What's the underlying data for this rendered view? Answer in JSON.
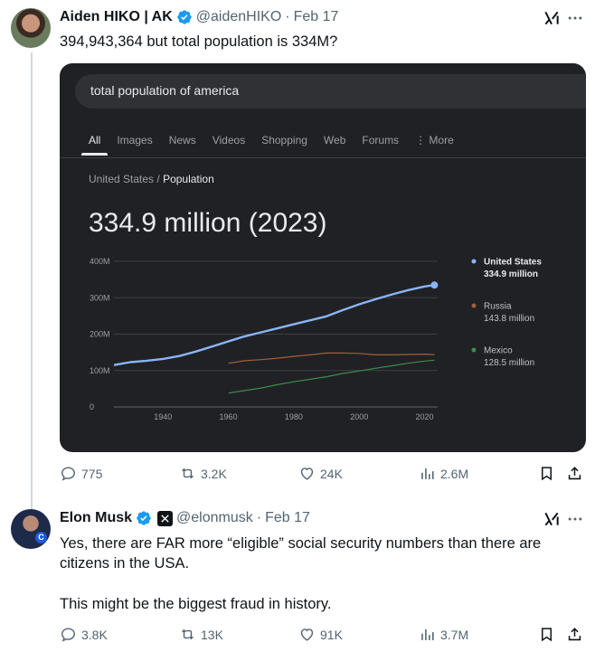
{
  "tweets": [
    {
      "name": "Aiden HIKO | AK",
      "handle": "@aidenHIKO",
      "date": "Feb 17",
      "text": "394,943,364 but total population is 334M?",
      "stats": {
        "replies": "775",
        "reposts": "3.2K",
        "likes": "24K",
        "views": "2.6M"
      }
    },
    {
      "name": "Elon Musk",
      "handle": "@elonmusk",
      "date": "Feb 17",
      "text_line1": "Yes, there are FAR more “eligible” social security numbers than there are",
      "text_line2": "citizens in the USA.",
      "text_line3": "This might be the biggest fraud in history.",
      "stats": {
        "replies": "3.8K",
        "reposts": "13K",
        "likes": "91K",
        "views": "3.7M"
      }
    }
  ],
  "embedded_search": {
    "query": "total population of america",
    "tabs": [
      "All",
      "Images",
      "News",
      "Videos",
      "Shopping",
      "Web",
      "Forums",
      "⋮ More"
    ],
    "active_tab": "All",
    "breadcrumb_parent": "United States",
    "breadcrumb_sep": " / ",
    "breadcrumb_current": "Population",
    "headline_value": "334.9 million (2023)"
  },
  "chart_data": {
    "type": "line",
    "y_ticks": [
      "400M",
      "300M",
      "200M",
      "100M",
      "0"
    ],
    "ylim": [
      0,
      400
    ],
    "xlim": [
      1925,
      2024
    ],
    "x_ticks": [
      1940,
      1960,
      1980,
      2000,
      2020
    ],
    "grid": true,
    "legend_position": "right",
    "series": [
      {
        "name": "United States",
        "label": "334.9 million",
        "color": "#8ab4f8",
        "x": [
          1925,
          1930,
          1935,
          1940,
          1945,
          1950,
          1955,
          1960,
          1965,
          1970,
          1975,
          1980,
          1985,
          1990,
          1995,
          2000,
          2005,
          2010,
          2015,
          2020,
          2023
        ],
        "values": [
          115,
          123,
          127,
          132,
          140,
          152,
          166,
          180,
          194,
          205,
          216,
          227,
          238,
          249,
          266,
          282,
          296,
          309,
          321,
          331,
          334.9
        ]
      },
      {
        "name": "Russia",
        "label": "143.8 million",
        "color": "#a0603b",
        "x": [
          1960,
          1965,
          1970,
          1975,
          1980,
          1985,
          1990,
          1995,
          2000,
          2005,
          2010,
          2015,
          2020,
          2023
        ],
        "values": [
          120,
          127,
          130,
          134,
          139,
          143,
          148,
          148,
          147,
          143,
          143,
          144,
          145,
          143.8
        ]
      },
      {
        "name": "Mexico",
        "label": "128.5 million",
        "color": "#3f8a4f",
        "x": [
          1960,
          1965,
          1970,
          1975,
          1980,
          1985,
          1990,
          1995,
          2000,
          2005,
          2010,
          2015,
          2020,
          2023
        ],
        "values": [
          38,
          45,
          52,
          61,
          69,
          76,
          83,
          92,
          99,
          106,
          113,
          120,
          126,
          128.5
        ]
      }
    ]
  }
}
